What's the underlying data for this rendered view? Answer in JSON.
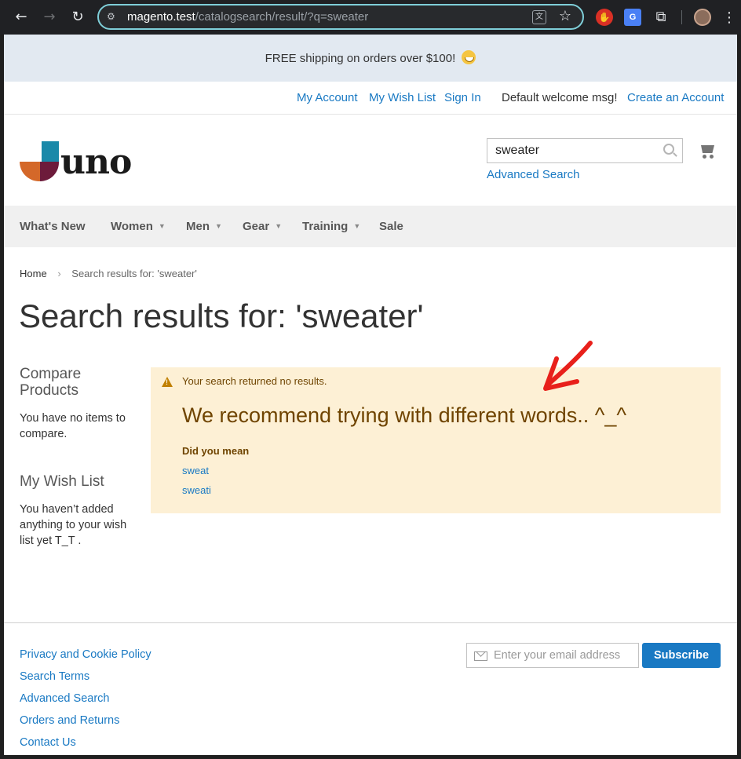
{
  "browser": {
    "url_host": "magento.test",
    "url_path": "/catalogsearch/result/?q=sweater",
    "nav": [
      "back-icon",
      "forward-icon",
      "reload-icon"
    ],
    "extensions": [
      "adblock-icon",
      "google-translate-icon",
      "extensions-icon",
      "profile-avatar"
    ]
  },
  "promo": {
    "text": "FREE shipping on orders over $100!"
  },
  "header": {
    "links": {
      "my_account": "My Account",
      "wish_list": "My Wish List",
      "sign_in": "Sign In",
      "welcome": "Default welcome msg!",
      "create_account": "Create an Account"
    },
    "logo_text": "uno",
    "search": {
      "value": "sweater",
      "advanced": "Advanced Search"
    }
  },
  "nav": {
    "items": [
      {
        "label": "What's New",
        "has_submenu": false
      },
      {
        "label": "Women",
        "has_submenu": true
      },
      {
        "label": "Men",
        "has_submenu": true
      },
      {
        "label": "Gear",
        "has_submenu": true
      },
      {
        "label": "Training",
        "has_submenu": true
      },
      {
        "label": "Sale",
        "has_submenu": false
      }
    ]
  },
  "breadcrumb": {
    "home": "Home",
    "current": "Search results for: 'sweater'"
  },
  "page_title": "Search results for: 'sweater'",
  "sidebar": {
    "compare_title": "Compare Products",
    "compare_empty": "You have no items to compare.",
    "wishlist_title": "My Wish List",
    "wishlist_empty": "You haven’t added anything to your wish list yet T_T ."
  },
  "message": {
    "notice": "Your search returned no results.",
    "recommend": "We recommend trying with different words.. ^_^",
    "did_you_mean": "Did you mean",
    "suggestions": [
      "sweat",
      "sweati"
    ]
  },
  "footer": {
    "links": [
      "Privacy and Cookie Policy",
      "Search Terms",
      "Advanced Search",
      "Orders and Returns",
      "Contact Us"
    ],
    "newsletter_placeholder": "Enter your email address",
    "subscribe_label": "Subscribe"
  },
  "colors": {
    "link": "#1979c3",
    "promo_bg": "#e2e9f1",
    "notice_bg": "#fdf0d5",
    "notice_text": "#6f4400",
    "annotation_arrow": "#e8201b"
  }
}
